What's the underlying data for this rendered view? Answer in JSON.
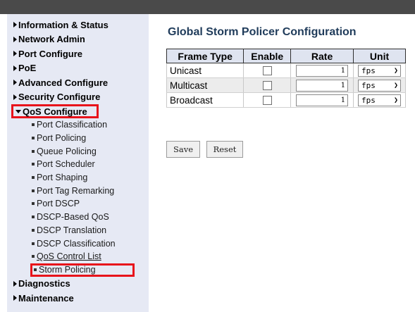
{
  "sidebar": {
    "items_top": [
      {
        "label": "Information & Status"
      },
      {
        "label": "Network Admin"
      },
      {
        "label": "Port Configure"
      },
      {
        "label": "PoE"
      },
      {
        "label": "Advanced Configure"
      },
      {
        "label": "Security Configure"
      }
    ],
    "qos": {
      "label": "QoS Configure",
      "subitems": [
        {
          "label": "Port Classification"
        },
        {
          "label": "Port Policing"
        },
        {
          "label": "Queue Policing"
        },
        {
          "label": "Port Scheduler"
        },
        {
          "label": "Port Shaping"
        },
        {
          "label": "Port Tag Remarking"
        },
        {
          "label": "Port DSCP"
        },
        {
          "label": "DSCP-Based QoS"
        },
        {
          "label": "DSCP Translation"
        },
        {
          "label": "DSCP Classification"
        },
        {
          "label": "QoS Control List"
        },
        {
          "label": "Storm Policing"
        }
      ]
    },
    "items_bottom": [
      {
        "label": "Diagnostics"
      },
      {
        "label": "Maintenance"
      }
    ]
  },
  "main": {
    "title": "Global Storm Policer Configuration",
    "table": {
      "headers": [
        "Frame Type",
        "Enable",
        "Rate",
        "Unit"
      ],
      "rows": [
        {
          "frame_type": "Unicast",
          "enabled": false,
          "rate": "1",
          "unit": "fps"
        },
        {
          "frame_type": "Multicast",
          "enabled": false,
          "rate": "1",
          "unit": "fps"
        },
        {
          "frame_type": "Broadcast",
          "enabled": false,
          "rate": "1",
          "unit": "fps"
        }
      ]
    },
    "buttons": {
      "save": "Save",
      "reset": "Reset"
    }
  },
  "colors": {
    "highlight": "#e8131b",
    "sidebar_bg": "#e6e9f4",
    "title": "#1f3b5a",
    "header_bg": "#dfe4f0"
  }
}
